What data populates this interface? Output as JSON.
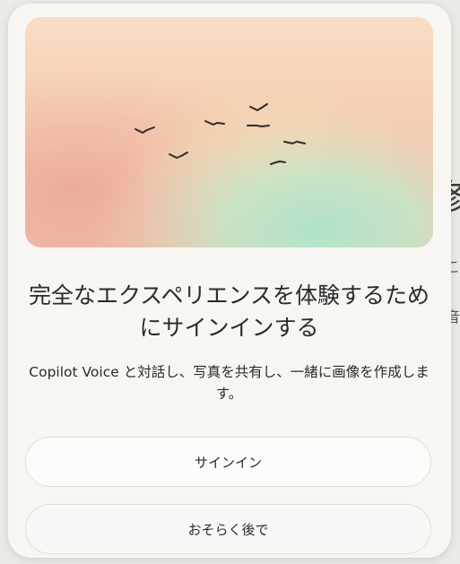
{
  "background": {
    "glyph_large": "修",
    "glyph_small_1": "こ",
    "glyph_small_2": "音"
  },
  "dialog": {
    "title": "完全なエクスペリエンスを体験するためにサインインする",
    "subtitle": "Copilot Voice と対話し、写真を共有し、一緒に画像を作成します。",
    "sign_in_label": "サインイン",
    "later_label": "おそらく後で"
  },
  "colors": {
    "hero_top": "#f7dcc6",
    "hero_peach": "#efb7a2",
    "hero_mint": "#b7e3cc",
    "dialog_bg": "#f8f6f3",
    "text": "#2b2b2b"
  },
  "icons": {
    "hero": "birds-flying-illustration"
  }
}
